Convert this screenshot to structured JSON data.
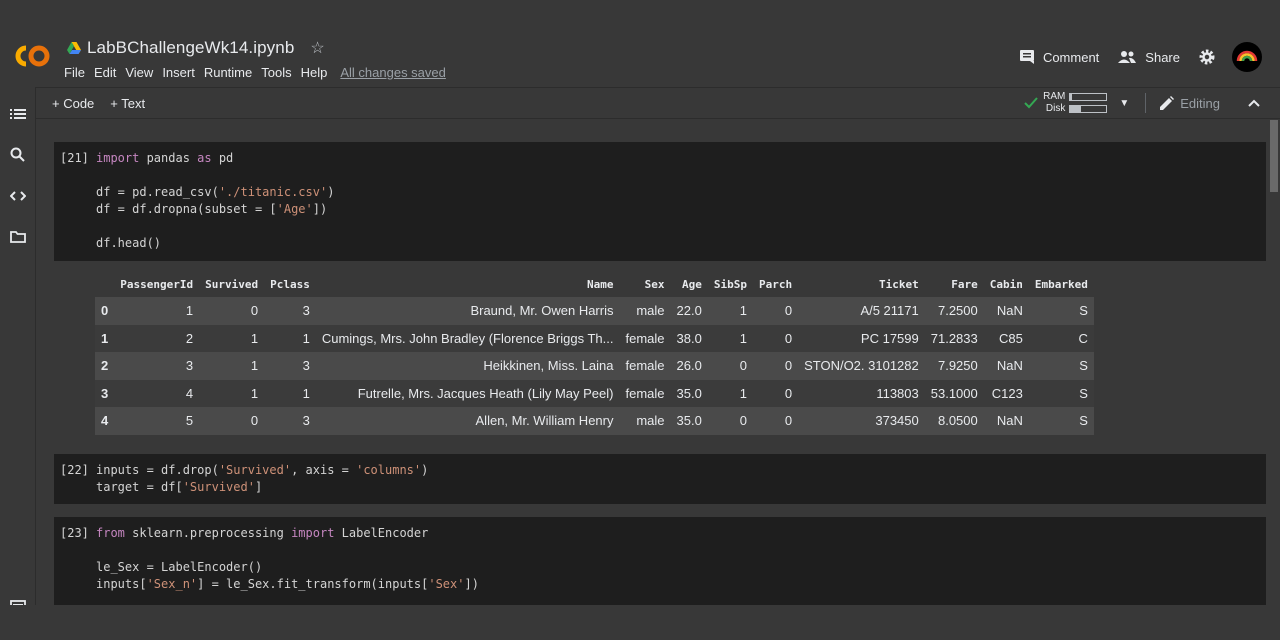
{
  "app": {
    "doc_title": "LabBChallengeWk14.ipynb",
    "menu": [
      "File",
      "Edit",
      "View",
      "Insert",
      "Runtime",
      "Tools",
      "Help"
    ],
    "save_status": "All changes saved",
    "comment_label": "Comment",
    "share_label": "Share"
  },
  "toolbar": {
    "add_code": "+ Code",
    "add_text": "+ Text",
    "ram_label": "RAM",
    "disk_label": "Disk",
    "ram_fraction": 0.05,
    "disk_fraction": 0.3,
    "editing_label": "Editing"
  },
  "icons": [
    "colab-logo-icon",
    "drive-icon",
    "star-icon",
    "comment-icon",
    "share-icon",
    "gear-icon",
    "avatar",
    "checkmark-icon",
    "chevron-down-icon",
    "pencil-icon",
    "chevron-up-icon",
    "toc-icon",
    "search-icon",
    "code-snippets-icon",
    "folder-icon",
    "terminal-icon"
  ],
  "cells": [
    {
      "prompt": "[21]",
      "lines": [
        [
          [
            "kw",
            "import"
          ],
          [
            "",
            " pandas "
          ],
          [
            "kw",
            "as"
          ],
          [
            "",
            " pd"
          ]
        ],
        [],
        [
          [
            "",
            "df = pd.read_csv("
          ],
          [
            "str",
            "'./titanic.csv'"
          ],
          [
            "",
            ")"
          ]
        ],
        [
          [
            "",
            "df = df.dropna(subset = ["
          ],
          [
            "str",
            "'Age'"
          ],
          [
            "",
            "])"
          ]
        ],
        [],
        [
          [
            "",
            "df.head()"
          ]
        ]
      ]
    },
    {
      "prompt": "[22]",
      "lines": [
        [
          [
            "",
            "inputs = df.drop("
          ],
          [
            "str",
            "'Survived'"
          ],
          [
            "",
            ", axis = "
          ],
          [
            "str",
            "'columns'"
          ],
          [
            "",
            ")"
          ]
        ],
        [
          [
            "",
            "target = df["
          ],
          [
            "str",
            "'Survived'"
          ],
          [
            "",
            "]"
          ]
        ]
      ]
    },
    {
      "prompt": "[23]",
      "lines": [
        [
          [
            "kw",
            "from"
          ],
          [
            "",
            " sklearn.preprocessing "
          ],
          [
            "kw",
            "import"
          ],
          [
            "",
            " LabelEncoder"
          ]
        ],
        [],
        [
          [
            "",
            "le_Sex = LabelEncoder()"
          ]
        ],
        [
          [
            "",
            "inputs["
          ],
          [
            "str",
            "'Sex_n'"
          ],
          [
            "",
            "] = le_Sex.fit_transform(inputs["
          ],
          [
            "str",
            "'Sex'"
          ],
          [
            "",
            "])"
          ]
        ]
      ]
    }
  ],
  "dataframe": {
    "columns": [
      "",
      "PassengerId",
      "Survived",
      "Pclass",
      "Name",
      "Sex",
      "Age",
      "SibSp",
      "Parch",
      "Ticket",
      "Fare",
      "Cabin",
      "Embarked"
    ],
    "rows": [
      [
        "0",
        "1",
        "0",
        "3",
        "Braund, Mr. Owen Harris",
        "male",
        "22.0",
        "1",
        "0",
        "A/5 21171",
        "7.2500",
        "NaN",
        "S"
      ],
      [
        "1",
        "2",
        "1",
        "1",
        "Cumings, Mrs. John Bradley (Florence Briggs Th...",
        "female",
        "38.0",
        "1",
        "0",
        "PC 17599",
        "71.2833",
        "C85",
        "C"
      ],
      [
        "2",
        "3",
        "1",
        "3",
        "Heikkinen, Miss. Laina",
        "female",
        "26.0",
        "0",
        "0",
        "STON/O2. 3101282",
        "7.9250",
        "NaN",
        "S"
      ],
      [
        "3",
        "4",
        "1",
        "1",
        "Futrelle, Mrs. Jacques Heath (Lily May Peel)",
        "female",
        "35.0",
        "1",
        "0",
        "113803",
        "53.1000",
        "C123",
        "S"
      ],
      [
        "4",
        "5",
        "0",
        "3",
        "Allen, Mr. William Henry",
        "male",
        "35.0",
        "0",
        "0",
        "373450",
        "8.0500",
        "NaN",
        "S"
      ]
    ]
  },
  "colors": {
    "keyword": "#c586c0",
    "string": "#ce9178",
    "accent_green": "#34a853",
    "logo_orange": "#f9ab00"
  }
}
